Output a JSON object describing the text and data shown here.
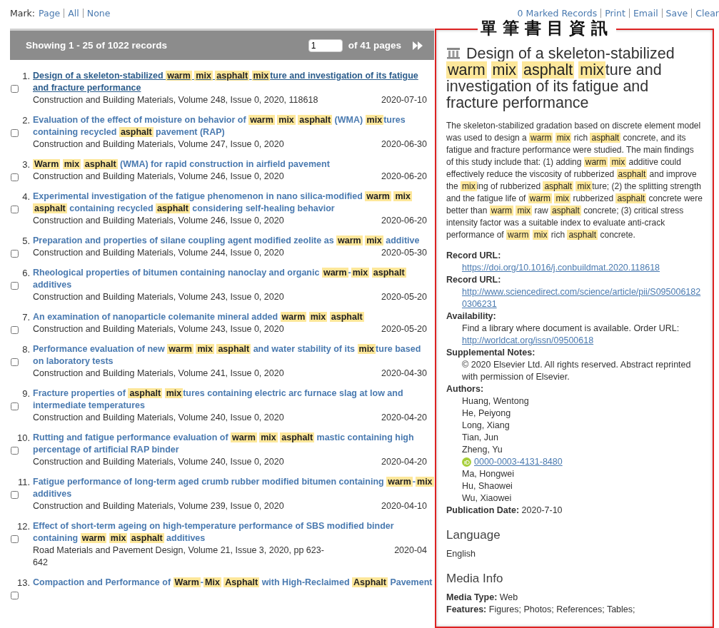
{
  "top_bar": {
    "mark_label": "Mark:",
    "mark_links": [
      "Page",
      "All",
      "None"
    ],
    "actions": [
      "0 Marked Records",
      "Print",
      "Email",
      "Save",
      "Clear"
    ]
  },
  "results_header": {
    "showing": "Showing 1 - 25 of 1022 records",
    "page_value": "1",
    "pages_text": "of 41 pages"
  },
  "results": [
    {
      "number": "1.",
      "selected": true,
      "checked": false,
      "title": [
        {
          "text": "Design of a skeleton-stabilized ",
          "highlight": false
        },
        {
          "text": "warm",
          "highlight": true
        },
        {
          "text": "mix",
          "highlight": true
        },
        {
          "text": "asphalt",
          "highlight": true
        },
        {
          "text": "mix",
          "highlight": true
        },
        {
          "text": "ture and investigation of its fatigue and fracture performance",
          "highlight": false
        }
      ],
      "source": "Construction and Building Materials, Volume 248, Issue 0, 2020, 118618",
      "date": "2020-07-10"
    },
    {
      "number": "2.",
      "selected": false,
      "checked": false,
      "title": [
        {
          "text": "Evaluation of the effect of moisture on behavior of ",
          "highlight": false
        },
        {
          "text": "warm",
          "highlight": true
        },
        {
          "text": "mix",
          "highlight": true
        },
        {
          "text": "asphalt",
          "highlight": true
        },
        {
          "text": " (WMA) ",
          "highlight": false
        },
        {
          "text": "mix",
          "highlight": true
        },
        {
          "text": "tures containing recycled ",
          "highlight": false
        },
        {
          "text": "asphalt",
          "highlight": true
        },
        {
          "text": " pavement (RAP)",
          "highlight": false
        }
      ],
      "source": "Construction and Building Materials, Volume 247, Issue 0, 2020",
      "date": "2020-06-30"
    },
    {
      "number": "3.",
      "selected": false,
      "checked": false,
      "title": [
        {
          "text": "Warm",
          "highlight": true
        },
        {
          "text": "mix",
          "highlight": true
        },
        {
          "text": "asphalt",
          "highlight": true
        },
        {
          "text": " (WMA) for rapid construction in airfield pavement",
          "highlight": false
        }
      ],
      "source": "Construction and Building Materials, Volume 246, Issue 0, 2020",
      "date": "2020-06-20"
    },
    {
      "number": "4.",
      "selected": false,
      "checked": false,
      "title": [
        {
          "text": "Experimental investigation of the fatigue phenomenon in nano silica-modified ",
          "highlight": false
        },
        {
          "text": "warm",
          "highlight": true
        },
        {
          "text": "mix",
          "highlight": true
        },
        {
          "text": "asphalt",
          "highlight": true
        },
        {
          "text": " containing recycled ",
          "highlight": false
        },
        {
          "text": "asphalt",
          "highlight": true
        },
        {
          "text": " considering self-healing behavior",
          "highlight": false
        }
      ],
      "source": "Construction and Building Materials, Volume 246, Issue 0, 2020",
      "date": "2020-06-20"
    },
    {
      "number": "5.",
      "selected": false,
      "checked": false,
      "title": [
        {
          "text": "Preparation and properties of silane coupling agent modified zeolite as ",
          "highlight": false
        },
        {
          "text": "warm",
          "highlight": true
        },
        {
          "text": "mix",
          "highlight": true
        },
        {
          "text": " additive",
          "highlight": false
        }
      ],
      "source": "Construction and Building Materials, Volume 244, Issue 0, 2020",
      "date": "2020-05-30"
    },
    {
      "number": "6.",
      "selected": false,
      "checked": false,
      "title": [
        {
          "text": "Rheological properties of bitumen containing nanoclay and organic ",
          "highlight": false
        },
        {
          "text": "warm",
          "highlight": true
        },
        {
          "text": "-",
          "highlight": false
        },
        {
          "text": "mix",
          "highlight": true
        },
        {
          "text": "asphalt",
          "highlight": true
        },
        {
          "text": " additives",
          "highlight": false
        }
      ],
      "source": "Construction and Building Materials, Volume 243, Issue 0, 2020",
      "date": "2020-05-20"
    },
    {
      "number": "7.",
      "selected": false,
      "checked": false,
      "title": [
        {
          "text": "An examination of nanoparticle colemanite mineral added ",
          "highlight": false
        },
        {
          "text": "warm",
          "highlight": true
        },
        {
          "text": "mix",
          "highlight": true
        },
        {
          "text": "asphalt",
          "highlight": true
        }
      ],
      "source": "Construction and Building Materials, Volume 243, Issue 0, 2020",
      "date": "2020-05-20"
    },
    {
      "number": "8.",
      "selected": false,
      "checked": false,
      "title": [
        {
          "text": "Performance evaluation of new ",
          "highlight": false
        },
        {
          "text": "warm",
          "highlight": true
        },
        {
          "text": "mix",
          "highlight": true
        },
        {
          "text": "asphalt",
          "highlight": true
        },
        {
          "text": " and water stability of its ",
          "highlight": false
        },
        {
          "text": "mix",
          "highlight": true
        },
        {
          "text": "ture based on laboratory tests",
          "highlight": false
        }
      ],
      "source": "Construction and Building Materials, Volume 241, Issue 0, 2020",
      "date": "2020-04-30"
    },
    {
      "number": "9.",
      "selected": false,
      "checked": false,
      "title": [
        {
          "text": "Fracture properties of ",
          "highlight": false
        },
        {
          "text": "asphalt",
          "highlight": true
        },
        {
          "text": "mix",
          "highlight": true
        },
        {
          "text": "tures containing electric arc furnace slag at low and intermediate temperatures",
          "highlight": false
        }
      ],
      "source": "Construction and Building Materials, Volume 240, Issue 0, 2020",
      "date": "2020-04-20"
    },
    {
      "number": "10.",
      "selected": false,
      "checked": false,
      "title": [
        {
          "text": "Rutting and fatigue performance evaluation of ",
          "highlight": false
        },
        {
          "text": "warm",
          "highlight": true
        },
        {
          "text": "mix",
          "highlight": true
        },
        {
          "text": "asphalt",
          "highlight": true
        },
        {
          "text": " mastic containing high percentage of artificial RAP binder",
          "highlight": false
        }
      ],
      "source": "Construction and Building Materials, Volume 240, Issue 0, 2020",
      "date": "2020-04-20"
    },
    {
      "number": "11.",
      "selected": false,
      "checked": false,
      "title": [
        {
          "text": "Fatigue performance of long-term aged crumb rubber modified bitumen containing ",
          "highlight": false
        },
        {
          "text": "warm",
          "highlight": true
        },
        {
          "text": "-",
          "highlight": false
        },
        {
          "text": "mix",
          "highlight": true
        },
        {
          "text": " additives",
          "highlight": false
        }
      ],
      "source": "Construction and Building Materials, Volume 239, Issue 0, 2020",
      "date": "2020-04-10"
    },
    {
      "number": "12.",
      "selected": false,
      "checked": false,
      "title": [
        {
          "text": "Effect of short-term ageing on high-temperature performance of SBS modified binder containing ",
          "highlight": false
        },
        {
          "text": "warm",
          "highlight": true
        },
        {
          "text": "mix",
          "highlight": true
        },
        {
          "text": "asphalt",
          "highlight": true
        },
        {
          "text": " additives",
          "highlight": false
        }
      ],
      "source": "Road Materials and Pavement Design, Volume 21, Issue 3, 2020, pp 623-642",
      "date": "2020-04"
    },
    {
      "number": "13.",
      "selected": false,
      "checked": false,
      "title": [
        {
          "text": "Compaction and Performance of ",
          "highlight": false
        },
        {
          "text": "Warm",
          "highlight": true
        },
        {
          "text": "-",
          "highlight": false
        },
        {
          "text": "Mix",
          "highlight": true
        },
        {
          "text": "Asphalt",
          "highlight": true
        },
        {
          "text": " with High-Reclaimed ",
          "highlight": false
        },
        {
          "text": "Asphalt",
          "highlight": true
        },
        {
          "text": " Pavement",
          "highlight": false
        }
      ]
    }
  ],
  "annotation": "單筆書目資訊",
  "detail": {
    "title": [
      {
        "text": "Design of a skeleton-stabilized ",
        "highlight": false
      },
      {
        "text": "warm",
        "highlight": true
      },
      {
        "text": "mix",
        "highlight": true
      },
      {
        "text": "asphalt",
        "highlight": true
      },
      {
        "text": "mix",
        "highlight": true
      },
      {
        "text": "ture and investigation of its fatigue and fracture performance",
        "highlight": false
      }
    ],
    "abstract": [
      {
        "text": "The skeleton-stabilized gradation based on discrete element model was used to design a ",
        "highlight": false
      },
      {
        "text": "warm",
        "highlight": true
      },
      {
        "text": "mix",
        "highlight": true
      },
      {
        "text": " rich ",
        "highlight": false
      },
      {
        "text": "asphalt",
        "highlight": true
      },
      {
        "text": " concrete, and its fatigue and fracture performance were studied. The main findings of this study include that: (1) adding ",
        "highlight": false
      },
      {
        "text": "warm",
        "highlight": true
      },
      {
        "text": "mix",
        "highlight": true
      },
      {
        "text": " additive could effectively reduce the viscosity of rubberized ",
        "highlight": false
      },
      {
        "text": "asphalt",
        "highlight": true
      },
      {
        "text": " and improve the ",
        "highlight": false
      },
      {
        "text": "mix",
        "highlight": true
      },
      {
        "text": "ing of rubberized ",
        "highlight": false
      },
      {
        "text": "asphalt",
        "highlight": true
      },
      {
        "text": "mix",
        "highlight": true
      },
      {
        "text": "ture; (2) the splitting strength and the fatigue life of ",
        "highlight": false
      },
      {
        "text": "warm",
        "highlight": true
      },
      {
        "text": "mix",
        "highlight": true
      },
      {
        "text": " rubberized ",
        "highlight": false
      },
      {
        "text": "asphalt",
        "highlight": true
      },
      {
        "text": " concrete were better than ",
        "highlight": false
      },
      {
        "text": "warm",
        "highlight": true
      },
      {
        "text": "mix",
        "highlight": true
      },
      {
        "text": " raw ",
        "highlight": false
      },
      {
        "text": "asphalt",
        "highlight": true
      },
      {
        "text": " concrete; (3) critical stress intensity factor was a suitable index to evaluate anti-crack performance of ",
        "highlight": false
      },
      {
        "text": "warm",
        "highlight": true
      },
      {
        "text": "mix",
        "highlight": true
      },
      {
        "text": " rich ",
        "highlight": false
      },
      {
        "text": "asphalt",
        "highlight": true
      },
      {
        "text": " concrete.",
        "highlight": false
      }
    ],
    "fields": [
      {
        "label": "Record URL:",
        "lines": [
          {
            "kind": "link",
            "text": "https://doi.org/10.1016/j.conbuildmat.2020.118618"
          }
        ]
      },
      {
        "label": "Record URL:",
        "lines": [
          {
            "kind": "link",
            "text": "http://www.sciencedirect.com/science/article/pii/S0950061820306231"
          }
        ]
      },
      {
        "label": "Availability:",
        "lines": [
          {
            "kind": "text",
            "text": "Find a library where document is available. Order URL:"
          },
          {
            "kind": "link",
            "text": "http://worldcat.org/issn/09500618"
          }
        ]
      },
      {
        "label": "Supplemental Notes:",
        "lines": [
          {
            "kind": "text",
            "text": "© 2020 Elsevier Ltd. All rights reserved. Abstract reprinted with permission of Elsevier."
          }
        ]
      },
      {
        "label": "Authors:",
        "lines": [
          {
            "kind": "text",
            "text": "Huang, Wentong"
          },
          {
            "kind": "text",
            "text": "He, Peiyong"
          },
          {
            "kind": "text",
            "text": "Long, Xiang"
          },
          {
            "kind": "text",
            "text": "Tian, Jun"
          },
          {
            "kind": "text",
            "text": "Zheng, Yu"
          },
          {
            "kind": "orcid",
            "text": "0000-0003-4131-8480"
          },
          {
            "kind": "text",
            "text": "Ma, Hongwei"
          },
          {
            "kind": "text",
            "text": "Hu, Shaowei"
          },
          {
            "kind": "text",
            "text": "Wu, Xiaowei"
          }
        ]
      }
    ],
    "publication_date": {
      "label": "Publication Date:",
      "value": "2020-7-10"
    },
    "sections": [
      {
        "heading": "Language",
        "lines": [
          {
            "kind": "text",
            "text": "English"
          }
        ]
      },
      {
        "heading": "Media Info",
        "lines": [
          {
            "kind": "pair",
            "label": "Media Type:",
            "text": "Web"
          },
          {
            "kind": "pair",
            "label": "Features:",
            "text": "Figures; Photos; References; Tables;"
          }
        ]
      }
    ]
  }
}
